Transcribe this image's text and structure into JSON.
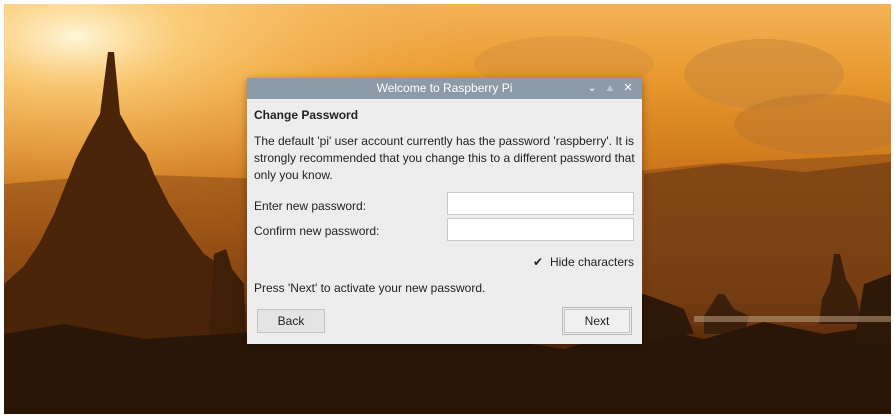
{
  "window": {
    "title": "Welcome to Raspberry Pi",
    "controls": {
      "minimize": "⌄",
      "maximize": "▲",
      "close": "✕"
    }
  },
  "page": {
    "heading": "Change Password",
    "description": "The default 'pi' user account currently has the password 'raspberry'. It is strongly recommended that you change this to a different password that only you know.",
    "new_password_label": "Enter new password:",
    "new_password_value": "",
    "confirm_password_label": "Confirm new password:",
    "confirm_password_value": "",
    "hide_characters_label": "Hide characters",
    "hide_characters_checked": true,
    "hint": "Press 'Next' to activate your new password."
  },
  "buttons": {
    "back": "Back",
    "next": "Next"
  },
  "colors": {
    "titlebar": "#8c9ba7",
    "dialog_bg": "#ededed"
  }
}
